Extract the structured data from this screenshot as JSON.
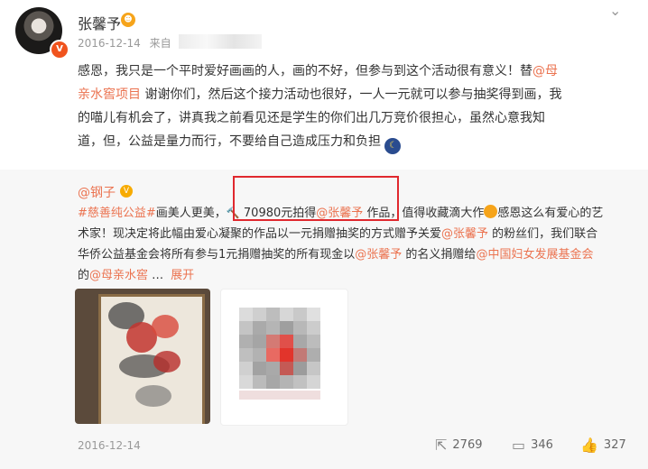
{
  "post": {
    "author": "张馨予",
    "date": "2016-12-14",
    "source_prefix": "来自",
    "lines": [
      [
        "感恩，我只是一个平时爱好画画的人，画的不好，但参与到这个活动很有意义！替",
        "@母"
      ],
      [
        "亲水窖项目",
        " 谢谢你们，然后这个接力活动也很好，一人一元就可以参与抽奖得到画，我"
      ],
      [
        "的喵儿有机会了，讲真我之前看见还是学生的你们出几万竞价很担心，虽然心意我知"
      ],
      [
        "道，但，公益是量力而行，不要给自己造成压力和负担"
      ]
    ]
  },
  "repost": {
    "author": "@钢子",
    "line1": {
      "tag": "#慈善纯公益#",
      "t1": "画美人更美，",
      "amount": " 70980元拍得",
      "mention": "@张馨予",
      "t2": " 作品，值得收藏滴大作",
      "t3": "感恩这么有爱心的艺"
    },
    "line2": "术家！现决定将此幅由爱心凝聚的作品以一元捐赠抽奖的方式赠予关爱",
    "line2_mention": "@张馨予",
    "line2_end": " 的粉丝们，我们联合",
    "line3": "华侨公益基金会将所有参与1元捐赠抽奖的所有现金以",
    "line3_mention": "@张馨予",
    "line3_mid": " 的名义捐赠给",
    "line3_org": "@中国妇女发展基金会",
    "line4_pre": "的",
    "line4_mention": "@母亲水窖",
    "line4_dots": " …",
    "line4_expand": "展开",
    "date": "2016-12-14",
    "actions": {
      "forward": "2769",
      "comment": "346",
      "like": "327"
    }
  },
  "icons": {
    "chevron": "chevron-down-icon",
    "forward": "forward-icon",
    "comment": "comment-icon",
    "like": "like-icon"
  },
  "colors": {
    "link": "#eb7350",
    "highlight": "#e0282e",
    "repost_bg": "#f7f7f7"
  }
}
